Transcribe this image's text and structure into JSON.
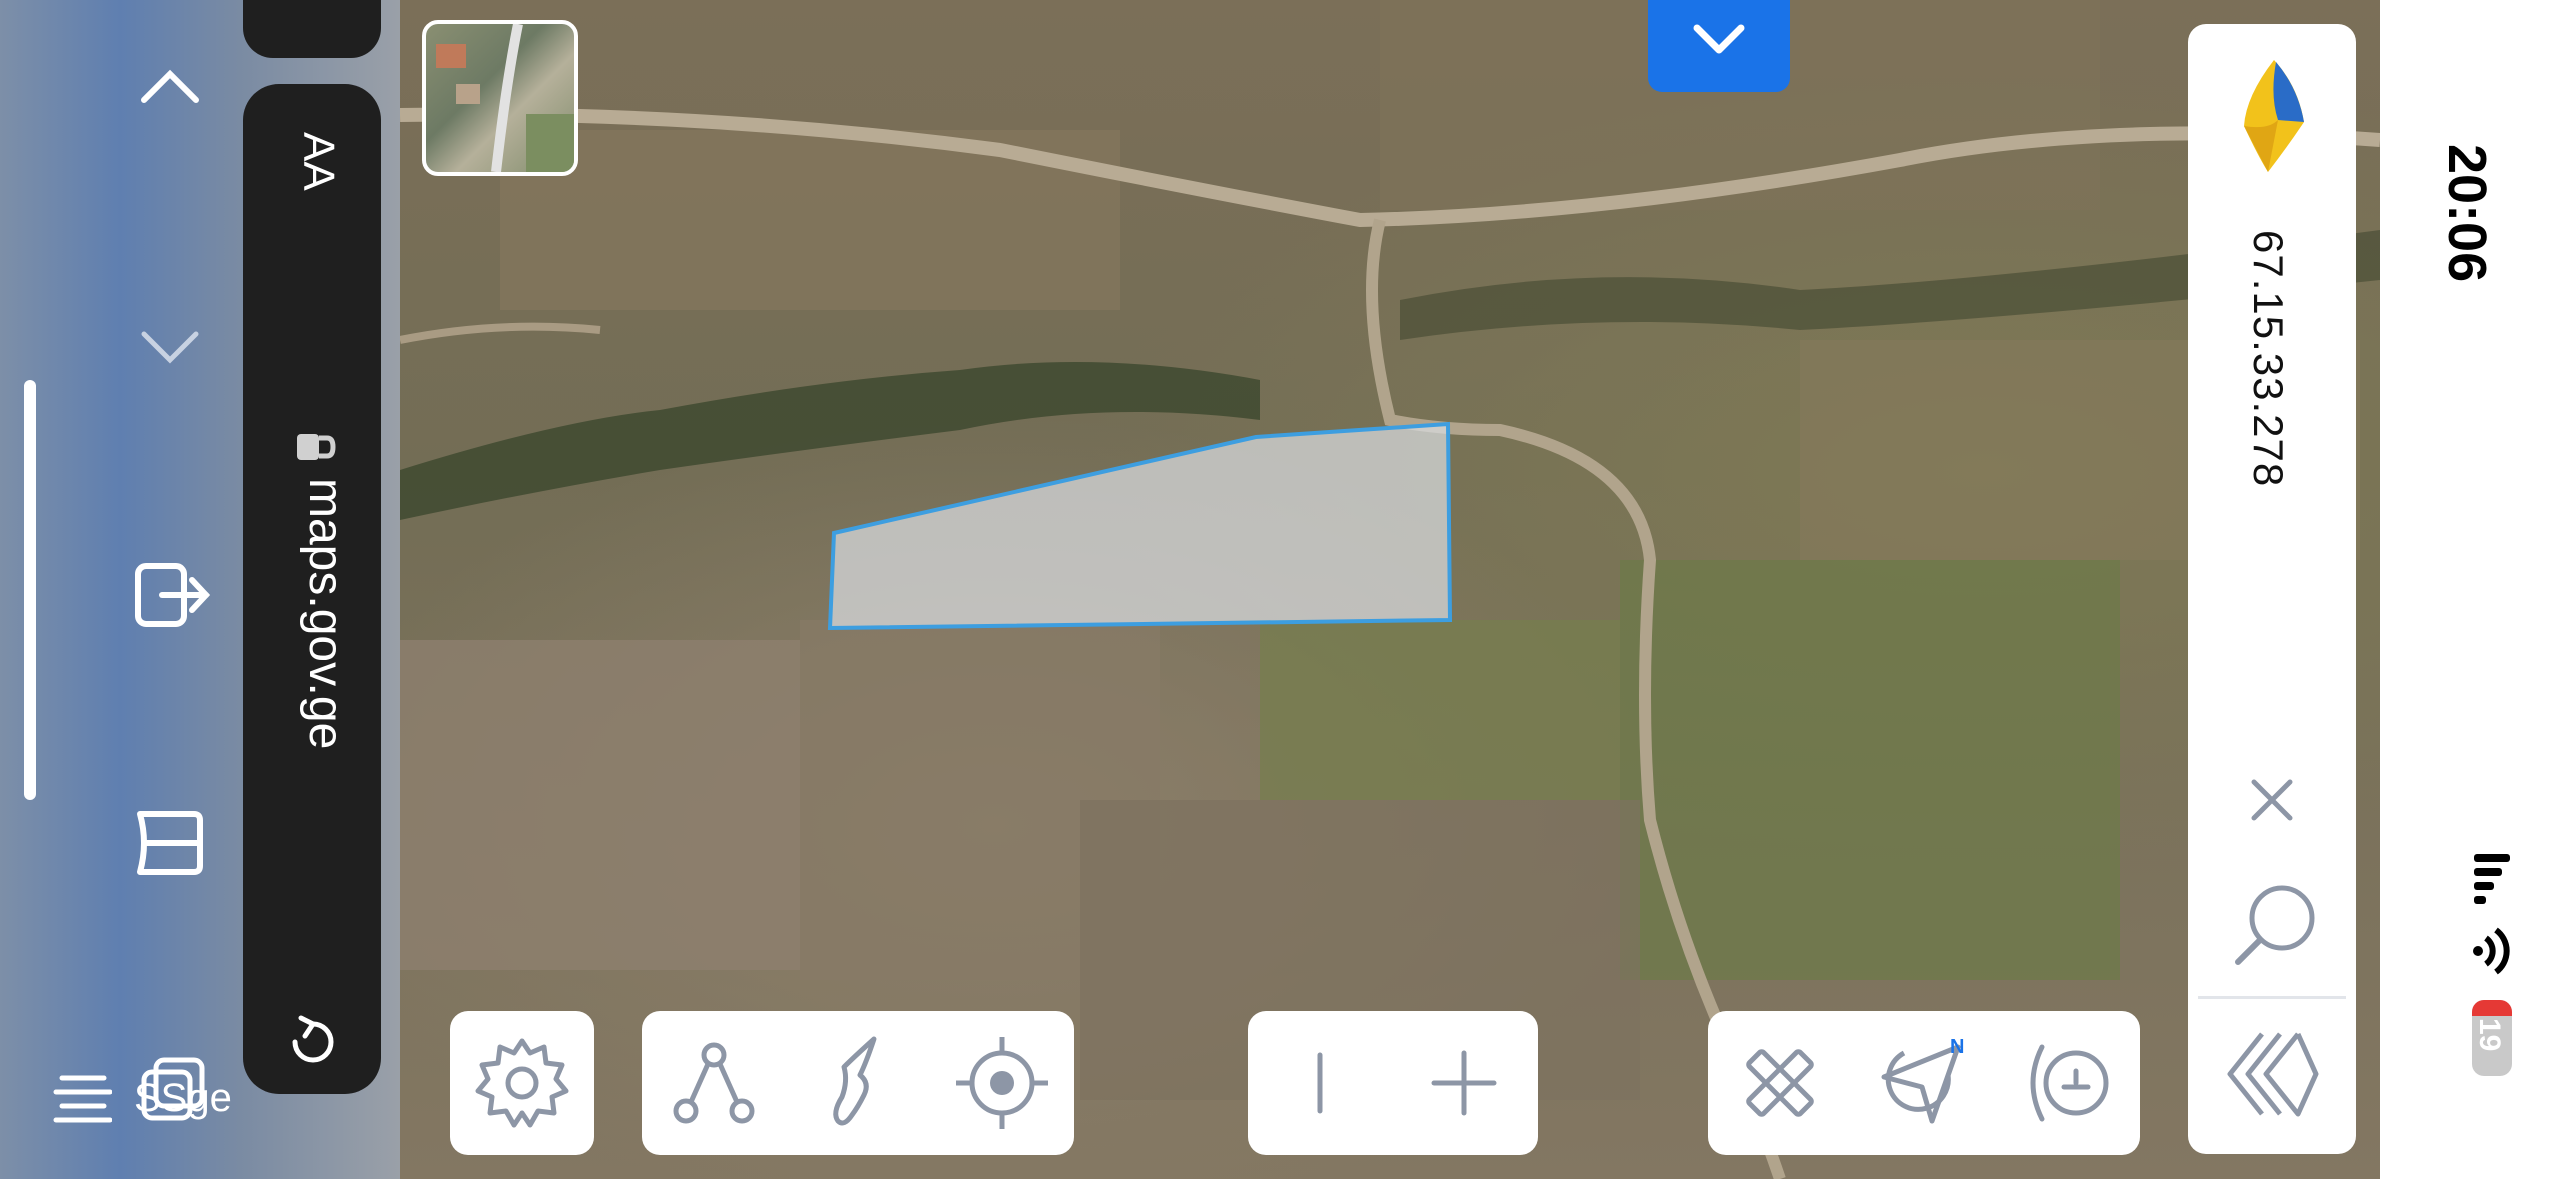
{
  "browser": {
    "url": "maps.gov.ge",
    "text_size_label": "AA",
    "bottom_label": "SSge"
  },
  "panel": {
    "cadastral_code": "67.15.33.278"
  },
  "status": {
    "time": "20:06",
    "battery": "19"
  },
  "icons": {
    "left": [
      "chevron-up-icon",
      "chevron-down-icon",
      "share-icon",
      "bookmarks-icon",
      "tabs-icon",
      "menu-icon"
    ],
    "toolbar_1": [
      "settings-icon"
    ],
    "toolbar_2": [
      "polygon-icon",
      "land-icon",
      "locate-icon"
    ],
    "toolbar_3": [
      "zoom-out-icon",
      "zoom-in-icon"
    ],
    "toolbar_4": [
      "measure-icon",
      "navigate-icon",
      "compass-icon"
    ],
    "panel": [
      "close-icon",
      "search-icon",
      "collapse-icon"
    ]
  },
  "colors": {
    "accent": "#1a73e8",
    "parcel_fill": "#d9dde0",
    "parcel_stroke": "#3d9ee0",
    "icon_gray": "#8d96a6"
  }
}
